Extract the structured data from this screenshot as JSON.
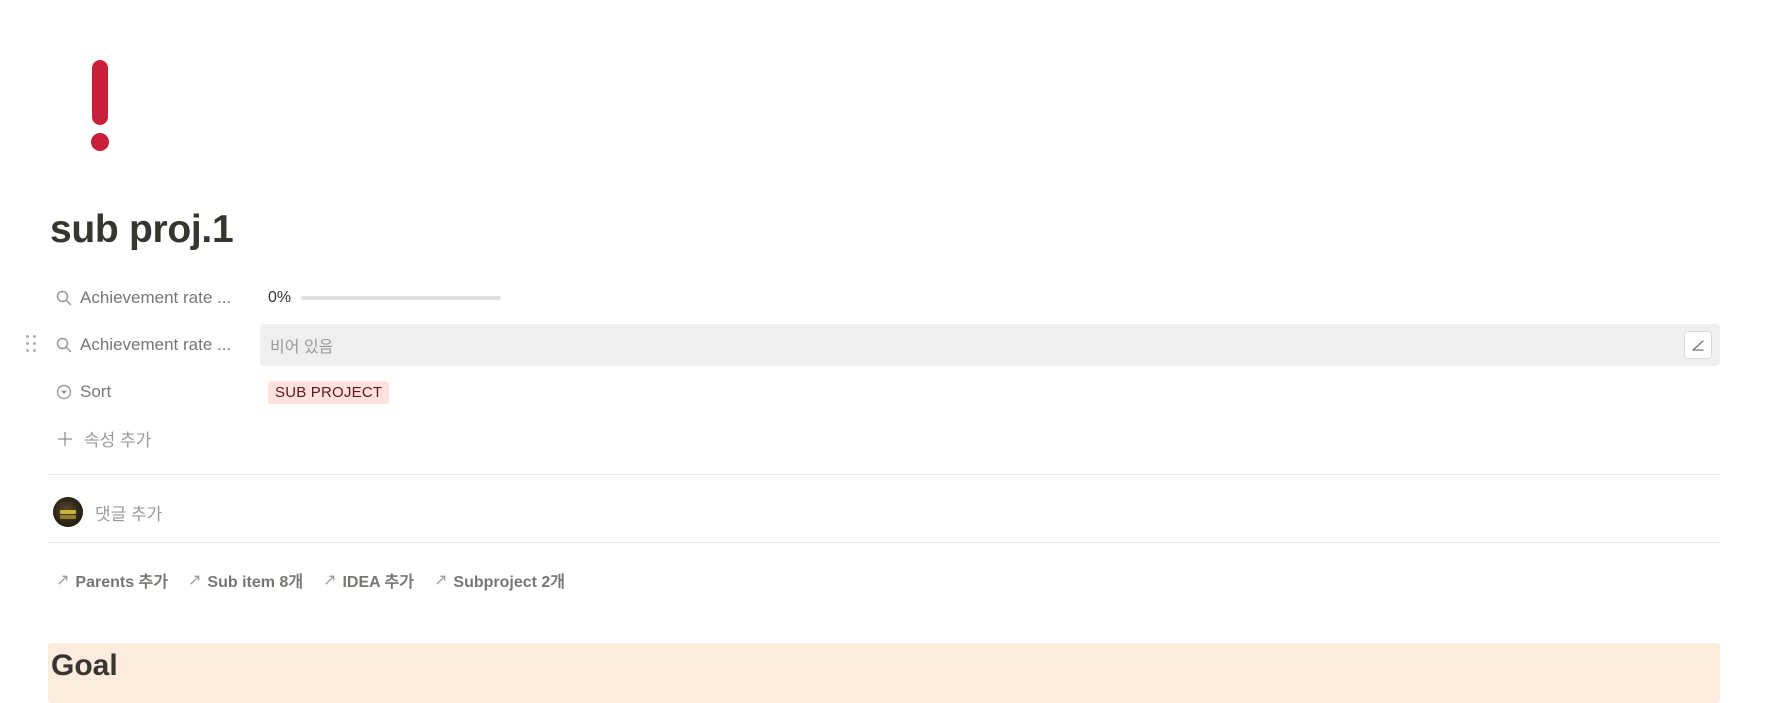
{
  "page": {
    "icon": "exclamation-mark-icon",
    "icon_color": "#c8203a",
    "title": "sub proj.1"
  },
  "properties": [
    {
      "label": "Achievement rate ...",
      "icon": "search-icon",
      "type": "progress",
      "value_text": "0%",
      "progress": 0,
      "bar_color": "#2eaadc"
    },
    {
      "label": "Achievement rate ...",
      "icon": "search-icon",
      "type": "empty",
      "value_text": "비어 있음"
    },
    {
      "label": "Sort",
      "icon": "select-icon",
      "type": "select",
      "value_text": "SUB PROJECT",
      "tag_bg": "#ffe2dd",
      "tag_color": "#5d1715"
    }
  ],
  "add_property_label": "속성 추가",
  "comment": {
    "placeholder": "댓글 추가"
  },
  "relations": [
    {
      "label": "Parents 추가"
    },
    {
      "label": "Sub item 8개"
    },
    {
      "label": "IDEA 추가"
    },
    {
      "label": "Subproject 2개"
    }
  ],
  "sections": {
    "goal_heading": "Goal",
    "goal_bg": "#fbecdd"
  }
}
